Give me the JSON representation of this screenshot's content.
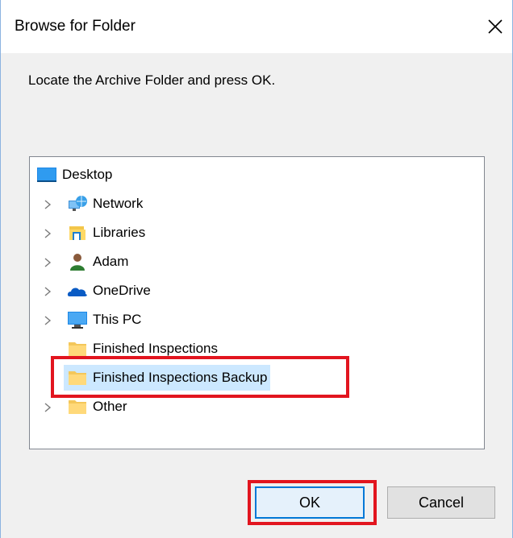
{
  "dialog": {
    "title": "Browse for Folder",
    "close_glyph": "✕",
    "instruction": "Locate the Archive Folder and press OK."
  },
  "tree": {
    "root": {
      "label": "Desktop",
      "icon": "desktop-icon"
    },
    "items": [
      {
        "label": "Network",
        "icon": "network-icon",
        "expandable": true
      },
      {
        "label": "Libraries",
        "icon": "libraries-icon",
        "expandable": true
      },
      {
        "label": "Adam",
        "icon": "user-icon",
        "expandable": true
      },
      {
        "label": "OneDrive",
        "icon": "onedrive-icon",
        "expandable": true
      },
      {
        "label": "This PC",
        "icon": "computer-icon",
        "expandable": true
      },
      {
        "label": "Finished Inspections",
        "icon": "folder-icon",
        "expandable": false
      },
      {
        "label": "Finished Inspections Backup",
        "icon": "folder-icon",
        "expandable": false,
        "selected": true
      },
      {
        "label": "Other",
        "icon": "folder-icon",
        "expandable": true
      }
    ]
  },
  "buttons": {
    "ok_label": "OK",
    "cancel_label": "Cancel"
  },
  "colors": {
    "highlight_red": "#e2151f",
    "selection": "#cce8ff",
    "accent": "#0078d7"
  }
}
